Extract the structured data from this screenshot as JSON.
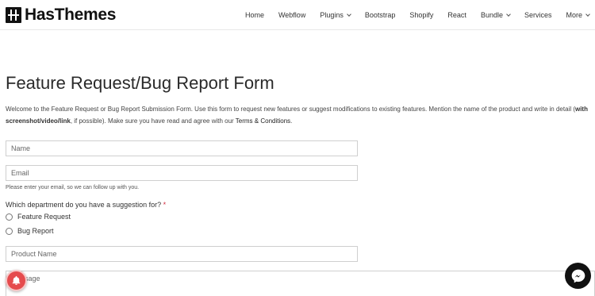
{
  "brand": {
    "name": "HasThemes"
  },
  "nav": {
    "items": [
      {
        "label": "Home",
        "dropdown": false
      },
      {
        "label": "Webflow",
        "dropdown": false
      },
      {
        "label": "Plugins",
        "dropdown": true
      },
      {
        "label": "Bootstrap",
        "dropdown": false
      },
      {
        "label": "Shopify",
        "dropdown": false
      },
      {
        "label": "React",
        "dropdown": false
      },
      {
        "label": "Bundle",
        "dropdown": true
      },
      {
        "label": "Services",
        "dropdown": false
      },
      {
        "label": "More",
        "dropdown": true
      }
    ]
  },
  "page": {
    "title": "Feature Request/Bug Report Form",
    "intro_1": "Welcome to the Feature Request or Bug Report Submission Form. Use this form to request new features or suggest modifications to existing features. Mention the name of the product and write in detail (",
    "intro_bold": "with screenshot/video/link",
    "intro_2": ", if possible). Make sure you have read and agree with our ",
    "intro_link": "Terms & Conditions",
    "intro_3": "."
  },
  "form": {
    "name_placeholder": "Name",
    "email_placeholder": "Email",
    "email_help": "Please enter your email, so we can follow up with you.",
    "department_question": "Which department do you have a suggestion for?",
    "required_mark": "*",
    "options": [
      "Feature Request",
      "Bug Report"
    ],
    "product_placeholder": "Product Name",
    "message_placeholder": "Message"
  },
  "colors": {
    "required": "#d1293d",
    "notification": "#e54b4d",
    "messenger": "#111111"
  },
  "icons": {
    "notification": "bell-icon",
    "messenger": "messenger-icon"
  }
}
